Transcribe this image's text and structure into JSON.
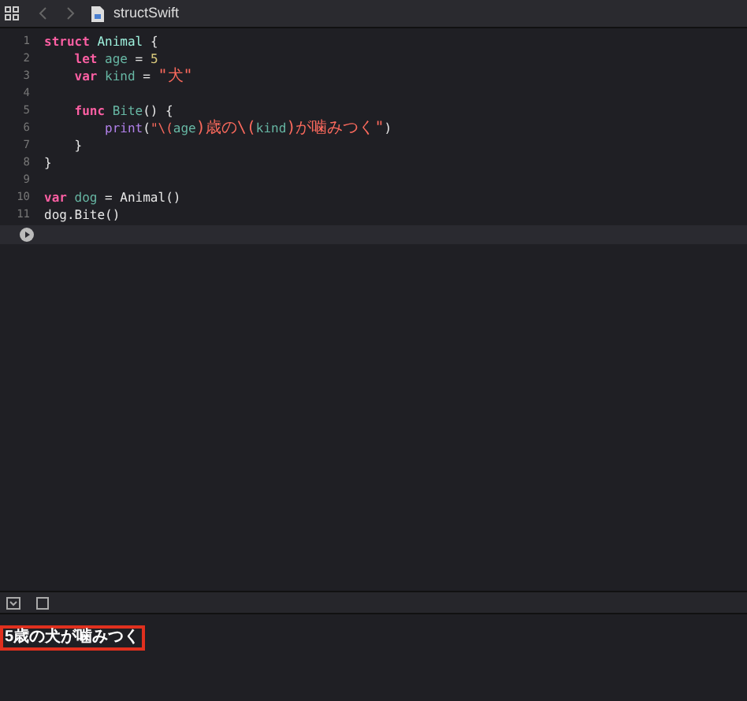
{
  "toolbar": {
    "file_name": "structSwift"
  },
  "editor": {
    "lines": [
      {
        "number": "1",
        "tokens": [
          {
            "kind": "keyword",
            "text": "struct"
          },
          {
            "kind": "type",
            "text": "Animal"
          },
          {
            "kind": "plain",
            "text": " {"
          }
        ],
        "children": [
          {
            "number": "2",
            "tokens": [
              {
                "kind": "keyword",
                "text": "let"
              },
              {
                "kind": "decl",
                "text": "age"
              },
              {
                "kind": "plain",
                "text": " = "
              },
              {
                "kind": "number",
                "text": "5"
              }
            ]
          },
          {
            "number": "3",
            "tokens": [
              {
                "kind": "keyword",
                "text": "var"
              },
              {
                "kind": "decl",
                "text": "kind"
              },
              {
                "kind": "plain",
                "text": " = "
              },
              {
                "kind": "string",
                "text": "\"犬\""
              }
            ]
          },
          {
            "number": "4"
          },
          {
            "number": "5",
            "tokens": [
              {
                "kind": "keyword",
                "text": "func"
              },
              {
                "kind": "decl",
                "text": "Bite"
              },
              {
                "kind": "plain",
                "text": "() {"
              }
            ],
            "children": [
              {
                "number": "6",
                "tokens": [
                  {
                    "kind": "call",
                    "text": "print"
                  },
                  {
                    "kind": "plain",
                    "text": "("
                  },
                  {
                    "kind": "string",
                    "text": "\"\\("
                  },
                  {
                    "kind": "decl",
                    "text": "age"
                  },
                  {
                    "kind": "string",
                    "text": ")歳の\\("
                  },
                  {
                    "kind": "decl",
                    "text": "kind"
                  },
                  {
                    "kind": "string",
                    "text": ")が噛みつく\""
                  },
                  {
                    "kind": "plain",
                    "text": ")"
                  }
                ]
              }
            ]
          },
          {
            "number": "7",
            "tokens": [
              {
                "kind": "plain",
                "text": "}"
              }
            ]
          }
        ]
      },
      {
        "number": "8",
        "tokens": [
          {
            "kind": "plain",
            "text": "}"
          }
        ]
      },
      {
        "number": "9"
      },
      {
        "number": "10",
        "tokens": [
          {
            "kind": "keyword",
            "text": "var"
          },
          {
            "kind": "decl",
            "text": "dog"
          },
          {
            "kind": "plain",
            "text": " = Animal()"
          }
        ]
      },
      {
        "number": "11",
        "tokens": [
          {
            "kind": "plain",
            "text": "dog.Bite()"
          }
        ]
      }
    ]
  },
  "console": {
    "output": "5歳の犬が噛みつく"
  }
}
